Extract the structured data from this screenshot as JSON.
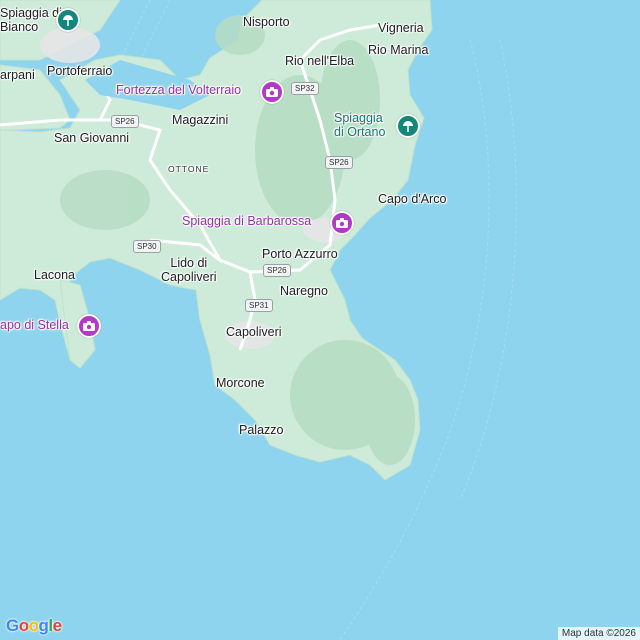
{
  "colors": {
    "sea": "#8fd4ee",
    "land": "#cdebd8",
    "hills": "#b6dcc4",
    "poi": "#b23ac6",
    "beach": "#14877a"
  },
  "places": [
    {
      "id": "spiaggia-di-biano",
      "line1": "Spiaggia di",
      "line2": "Bianco"
    },
    {
      "id": "nisporto",
      "text": "Nisporto"
    },
    {
      "id": "vigneria",
      "text": "Vigneria"
    },
    {
      "id": "rio-marina",
      "text": "Rio Marina"
    },
    {
      "id": "rio-nell-elba",
      "text": "Rio nell'Elba"
    },
    {
      "id": "carpani",
      "text": "arpani"
    },
    {
      "id": "portoferraio",
      "text": "Portoferraio"
    },
    {
      "id": "magazzini",
      "text": "Magazzini"
    },
    {
      "id": "san-giovanni",
      "text": "San Giovanni"
    },
    {
      "id": "ottone",
      "text": "OTTONE"
    },
    {
      "id": "capo-d-arco",
      "text": "Capo d'Arco"
    },
    {
      "id": "lacona",
      "text": "Lacona"
    },
    {
      "id": "lido-di-capoliveri",
      "line1": "Lido di",
      "line2": "Capoliveri"
    },
    {
      "id": "porto-azzurro",
      "text": "Porto Azzurro"
    },
    {
      "id": "naregno",
      "text": "Naregno"
    },
    {
      "id": "capoliveri",
      "text": "Capoliveri"
    },
    {
      "id": "morcone",
      "text": "Morcone"
    },
    {
      "id": "palazzo",
      "text": "Palazzo"
    }
  ],
  "pois": [
    {
      "id": "fortezza-del-volterraio",
      "text": "Fortezza del Volterraio",
      "icon": "camera-icon"
    },
    {
      "id": "spiaggia-di-barbarossa",
      "text": "Spiaggia di Barbarossa",
      "icon": "camera-icon"
    },
    {
      "id": "capo-di-stella",
      "text": "apo di Stella",
      "icon": "camera-icon"
    },
    {
      "id": "spiaggia-di-ortano",
      "line1": "Spiaggia",
      "line2": "di Ortano",
      "icon": "beach-umbrella-icon"
    }
  ],
  "roads": [
    "SP32",
    "SP26",
    "SP26",
    "SP30",
    "SP26",
    "SP31"
  ],
  "logo": {
    "text": "Google"
  },
  "attribution": "Map data ©2026"
}
